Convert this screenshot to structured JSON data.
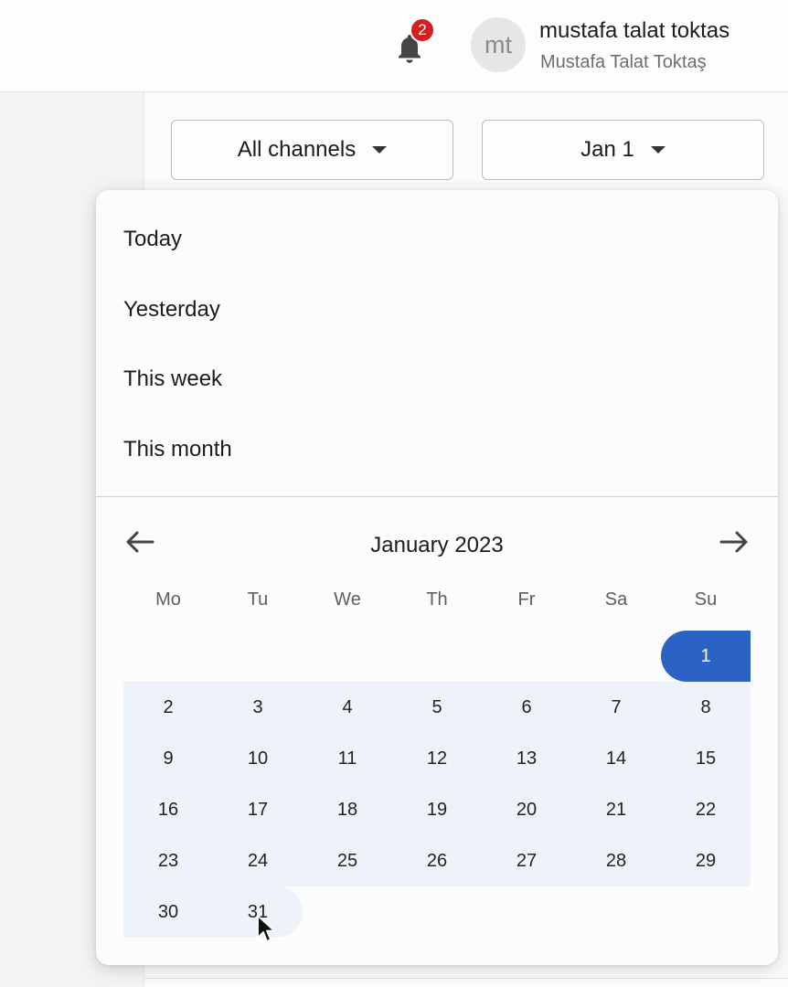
{
  "header": {
    "notifications_count": "2",
    "avatar_initials": "mt",
    "username": "mustafa talat toktas",
    "display_name": "Mustafa Talat Toktaş"
  },
  "filters": {
    "channels_label": "All channels",
    "date_label": "Jan 1"
  },
  "date_popup": {
    "presets": [
      "Today",
      "Yesterday",
      "This week",
      "This month"
    ],
    "month_title": "January 2023",
    "weekdays": [
      "Mo",
      "Tu",
      "We",
      "Th",
      "Fr",
      "Sa",
      "Su"
    ],
    "first_weekday_index": 6,
    "days_in_month": 31,
    "selected_start": 1,
    "selected_end": 31,
    "colors": {
      "selected": "#2a63c3",
      "range": "#eef3fa"
    }
  }
}
